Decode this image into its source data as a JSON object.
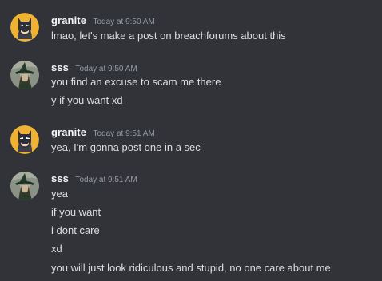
{
  "messages": [
    {
      "username": "granite",
      "timestamp": "Today at 9:50 AM",
      "avatar": "batman-avatar",
      "lines": [
        "lmao, let's make a post on breachforums about this"
      ]
    },
    {
      "username": "sss",
      "timestamp": "Today at 9:50 AM",
      "avatar": "witch-avatar",
      "lines": [
        "you find an excuse to scam me there",
        "y if you want xd"
      ]
    },
    {
      "username": "granite",
      "timestamp": "Today at 9:51 AM",
      "avatar": "batman-avatar",
      "lines": [
        "yea, I'm gonna post one in a sec"
      ]
    },
    {
      "username": "sss",
      "timestamp": "Today at 9:51 AM",
      "avatar": "witch-avatar",
      "lines": [
        "yea",
        "if you want",
        "i dont care",
        "xd",
        "you will just look ridiculous and stupid, no one care about me"
      ]
    }
  ],
  "colors": {
    "background": "#313338",
    "username": "#f2f3f5",
    "timestamp": "#949ba4",
    "text": "#dbdee1",
    "batman_bg": "#f0b232"
  }
}
